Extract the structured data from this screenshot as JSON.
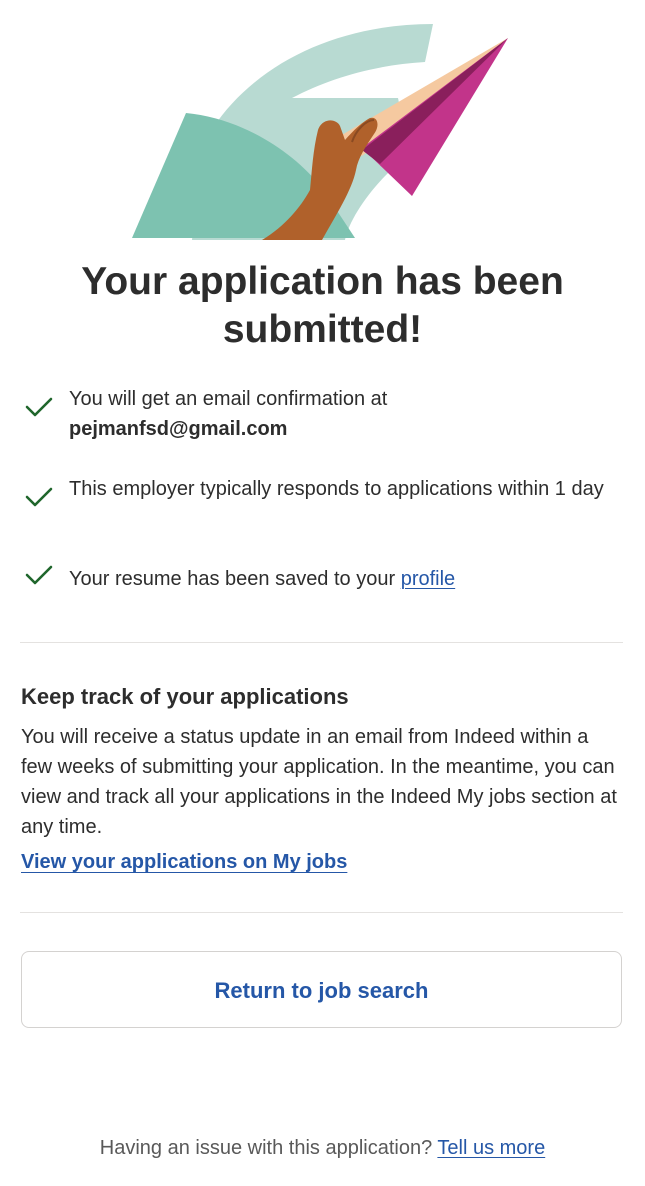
{
  "illustration": {
    "icon": "hand-holding-paper-plane-illustration",
    "colors": {
      "teal_light": "#b8dad2",
      "teal": "#7dc2b0",
      "hand": "#b0612b",
      "peach": "#f5c9a0",
      "magenta": "#c2348a",
      "magenta_dark": "#8a1f5c"
    }
  },
  "confirmation": {
    "title": "Your application has been submitted!"
  },
  "checklist": {
    "check_icon": "checkmark-icon",
    "check_color": "#1f662c",
    "item1_text": "You will get an email confirmation at",
    "item1_email": "pejmanfsd@gmail.com",
    "item2_text": "This employer typically responds to applications within 1 day",
    "item3_text": "Your resume has been saved to your ",
    "item3_link": "profile"
  },
  "tracking": {
    "heading": "Keep track of your applications",
    "body": "You will receive a status update in an email from Indeed within a few weeks of submitting your application. In the meantime, you can view and track all your applications in the Indeed My jobs section at any time.",
    "link": "View your applications on My jobs"
  },
  "actions": {
    "return_label": "Return to job search"
  },
  "footer": {
    "text": "Having an issue with this application? ",
    "link": "Tell us more"
  },
  "colors": {
    "link": "#2557a7",
    "text": "#2d2d2d",
    "muted": "#595959",
    "divider": "#e4e2e0"
  }
}
